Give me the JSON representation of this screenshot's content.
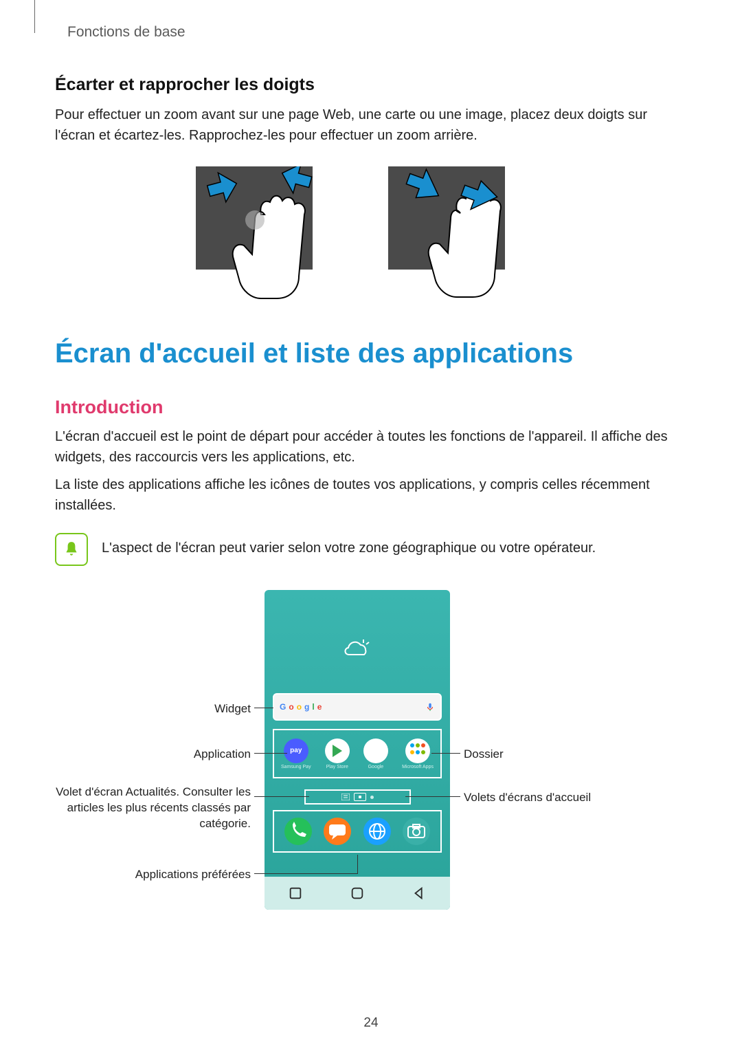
{
  "header": {
    "section": "Fonctions de base"
  },
  "pinch": {
    "heading": "Écarter et rapprocher les doigts",
    "body": "Pour effectuer un zoom avant sur une page Web, une carte ou une image, placez deux doigts sur l'écran et écartez-les. Rapprochez-les pour effectuer un zoom arrière."
  },
  "main_heading": "Écran d'accueil et liste des applications",
  "intro": {
    "heading": "Introduction",
    "p1": "L'écran d'accueil est le point de départ pour accéder à toutes les fonctions de l'appareil. Il affiche des widgets, des raccourcis vers les applications, etc.",
    "p2": "La liste des applications affiche les icônes de toutes vos applications, y compris celles récemment installées."
  },
  "note": {
    "text": "L'aspect de l'écran peut varier selon votre zone géographique ou votre opérateur."
  },
  "diagram": {
    "left": {
      "widget": "Widget",
      "application": "Application",
      "news": "Volet d'écran Actualités. Consulter les articles les plus récents classés par catégorie.",
      "fav": "Applications préférées"
    },
    "right": {
      "folder": "Dossier",
      "panels": "Volets d'écrans d'accueil"
    },
    "apps": {
      "pay": "pay",
      "a1": "Samsung Pay",
      "a2": "Play Store",
      "a3": "Google",
      "a4": "Microsoft Apps"
    }
  },
  "page_number": "24"
}
